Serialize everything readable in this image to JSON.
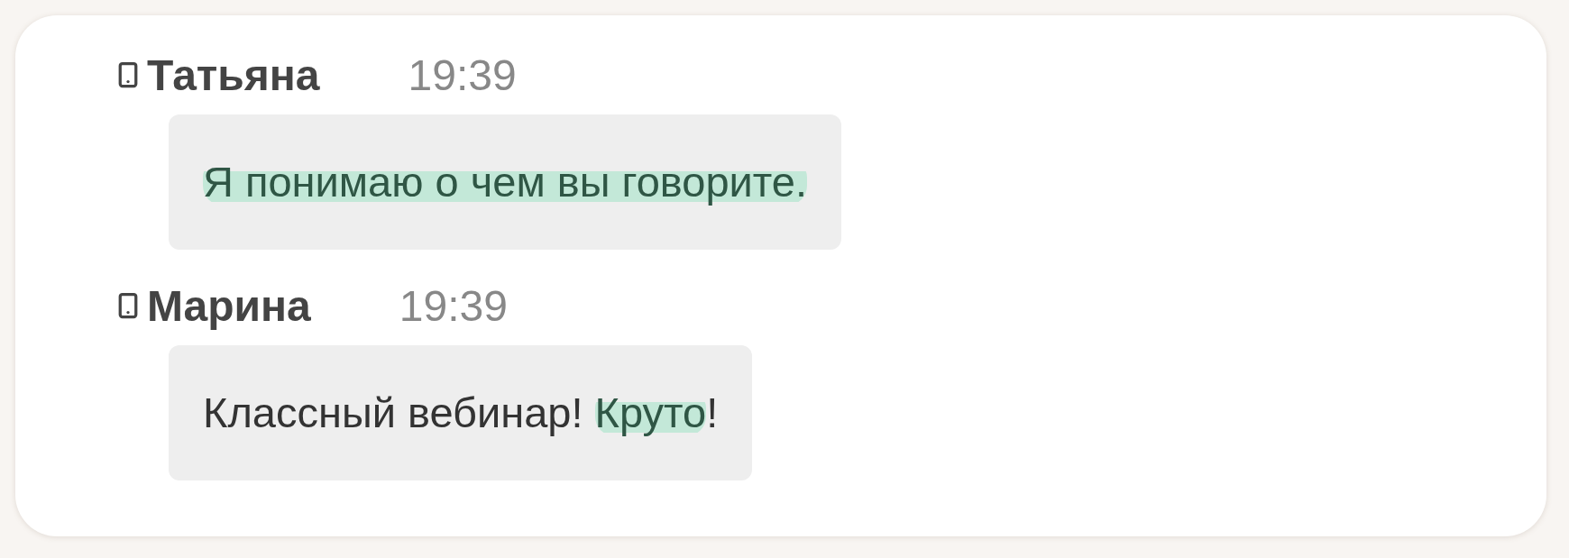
{
  "messages": [
    {
      "author": "Татьяна",
      "time": "19:39",
      "segments": [
        {
          "text": "Я понимаю о чем вы говорите.",
          "highlighted": true
        }
      ]
    },
    {
      "author": "Марина",
      "time": "19:39",
      "segments": [
        {
          "text": "Классный вебинар! ",
          "highlighted": false
        },
        {
          "text": "Круто",
          "highlighted": true
        },
        {
          "text": "!",
          "highlighted": false
        }
      ]
    }
  ]
}
